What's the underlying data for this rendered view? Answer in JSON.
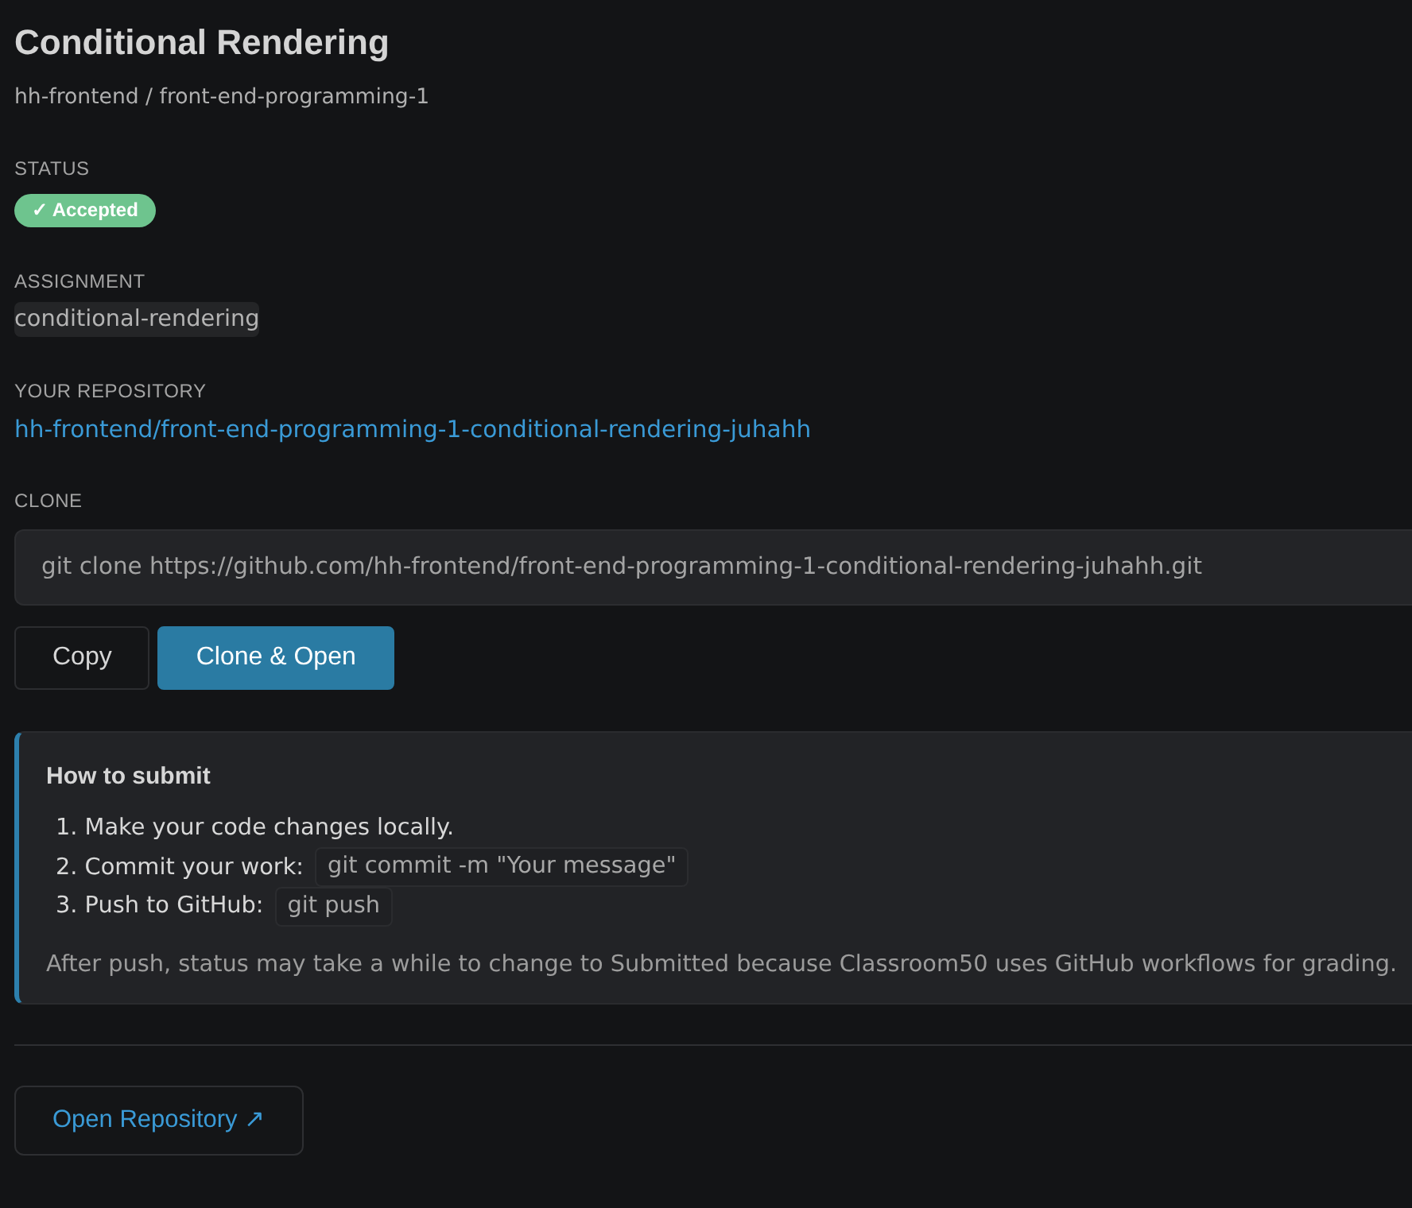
{
  "header": {
    "title": "Conditional Rendering",
    "subtitle": "hh-frontend / front-end-programming-1"
  },
  "status": {
    "label": "STATUS",
    "value": "✓ Accepted",
    "kind": "accepted"
  },
  "assignment": {
    "label": "ASSIGNMENT",
    "value": "conditional-rendering"
  },
  "repository": {
    "label": "YOUR REPOSITORY",
    "link": "hh-frontend/front-end-programming-1-conditional-rendering-juhahh"
  },
  "clone": {
    "label": "CLONE",
    "command": "git clone https://github.com/hh-frontend/front-end-programming-1-conditional-rendering-juhahh.git",
    "buttons": [
      {
        "label": "Copy",
        "kind": "secondary"
      },
      {
        "label": "Clone & Open",
        "kind": "primary"
      }
    ]
  },
  "submit_card": {
    "title": "How to submit",
    "steps": [
      {
        "text": "1. Make your code changes locally."
      },
      {
        "text": "2. Commit your work:",
        "code": "git commit -m \"Your message\""
      },
      {
        "text": "3. Push to GitHub:",
        "code": "git push"
      }
    ],
    "note": "After push, status may take a while to change to Submitted because Classroom50 uses GitHub workflows for grading."
  },
  "footer": {
    "button": "Open Repository ↗"
  }
}
